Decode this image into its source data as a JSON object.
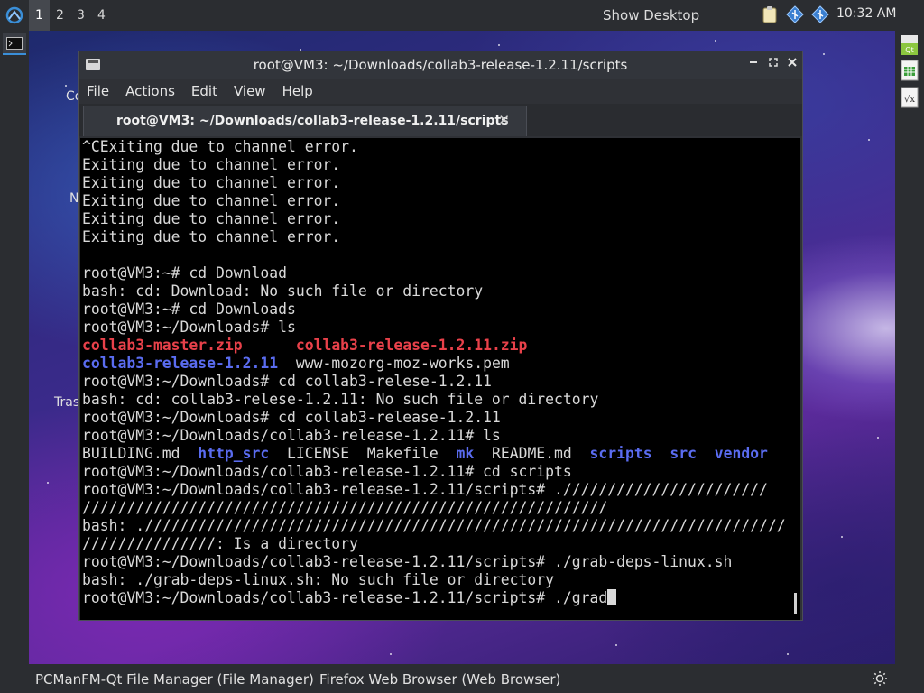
{
  "top_panel": {
    "desktops": [
      "1",
      "2",
      "3",
      "4"
    ],
    "active_desktop": "1",
    "show_desktop_label": "Show Desktop",
    "clock": "10:32 AM",
    "tray_icons": [
      "clipboard-icon",
      "network-icon",
      "network-icon"
    ]
  },
  "desktop_labels": [
    "Co",
    "N",
    "Tras"
  ],
  "right_dock_icons": [
    "qt-icon",
    "spreadsheet-icon",
    "formula-icon"
  ],
  "window": {
    "title": "root@VM3: ~/Downloads/collab3-release-1.2.11/scripts",
    "menu": [
      "File",
      "Actions",
      "Edit",
      "View",
      "Help"
    ],
    "tab_label": "root@VM3: ~/Downloads/collab3-release-1.2.11/scripts"
  },
  "terminal": {
    "lines": [
      [
        {
          "t": "^CExiting due to channel error."
        }
      ],
      [
        {
          "t": "Exiting due to channel error."
        }
      ],
      [
        {
          "t": "Exiting due to channel error."
        }
      ],
      [
        {
          "t": "Exiting due to channel error."
        }
      ],
      [
        {
          "t": "Exiting due to channel error."
        }
      ],
      [
        {
          "t": "Exiting due to channel error."
        }
      ],
      [
        {
          "t": ""
        }
      ],
      [
        {
          "t": "root@VM3:~# cd Download"
        }
      ],
      [
        {
          "t": "bash: cd: Download: No such file or directory"
        }
      ],
      [
        {
          "t": "root@VM3:~# cd Downloads"
        }
      ],
      [
        {
          "t": "root@VM3:~/Downloads# ls"
        }
      ],
      [
        {
          "t": "collab3-master.zip",
          "c": "red"
        },
        {
          "t": "      "
        },
        {
          "t": "collab3-release-1.2.11.zip",
          "c": "red"
        }
      ],
      [
        {
          "t": "collab3-release-1.2.11",
          "c": "blue"
        },
        {
          "t": "  www-mozorg-moz-works.pem"
        }
      ],
      [
        {
          "t": "root@VM3:~/Downloads# cd collab3-relese-1.2.11"
        }
      ],
      [
        {
          "t": "bash: cd: collab3-relese-1.2.11: No such file or directory"
        }
      ],
      [
        {
          "t": "root@VM3:~/Downloads# cd collab3-release-1.2.11"
        }
      ],
      [
        {
          "t": "root@VM3:~/Downloads/collab3-release-1.2.11# ls"
        }
      ],
      [
        {
          "t": "BUILDING.md  "
        },
        {
          "t": "http_src",
          "c": "blue"
        },
        {
          "t": "  LICENSE  Makefile  "
        },
        {
          "t": "mk",
          "c": "blue"
        },
        {
          "t": "  README.md  "
        },
        {
          "t": "scripts",
          "c": "blue"
        },
        {
          "t": "  "
        },
        {
          "t": "src",
          "c": "blue"
        },
        {
          "t": "  "
        },
        {
          "t": "vendor",
          "c": "blue"
        }
      ],
      [
        {
          "t": "root@VM3:~/Downloads/collab3-release-1.2.11# cd scripts"
        }
      ],
      [
        {
          "t": "root@VM3:~/Downloads/collab3-release-1.2.11/scripts# .///////////////////////"
        }
      ],
      [
        {
          "t": "///////////////////////////////////////////////////////////"
        }
      ],
      [
        {
          "t": "bash: .////////////////////////////////////////////////////////////////////////"
        }
      ],
      [
        {
          "t": "///////////////: Is a directory"
        }
      ],
      [
        {
          "t": "root@VM3:~/Downloads/collab3-release-1.2.11/scripts# ./grab-deps-linux.sh"
        }
      ],
      [
        {
          "t": "bash: ./grab-deps-linux.sh: No such file or directory"
        }
      ],
      [
        {
          "t": "root@VM3:~/Downloads/collab3-release-1.2.11/scripts# ./grad"
        }
      ]
    ]
  },
  "taskbar": {
    "tasks": [
      "PCManFM-Qt File Manager (File Manager)",
      "Firefox Web Browser (Web Browser)"
    ]
  }
}
